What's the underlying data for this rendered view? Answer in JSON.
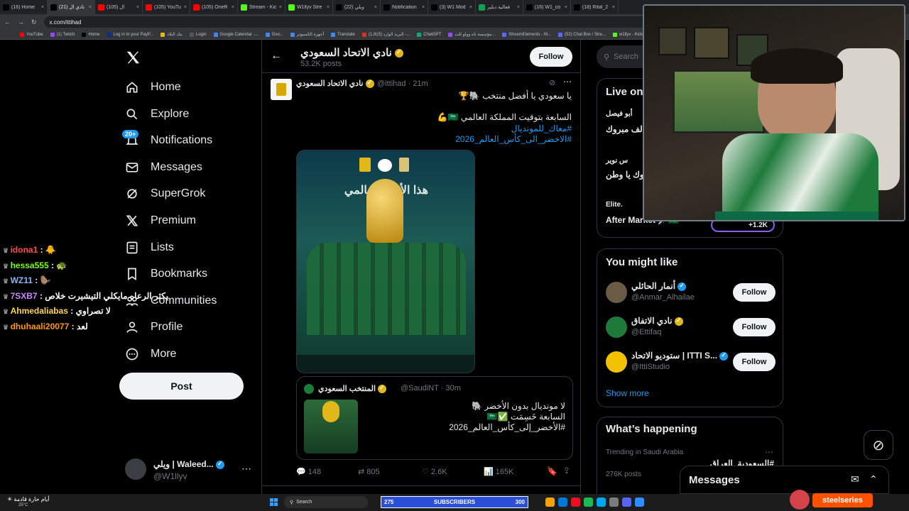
{
  "browser": {
    "tabs": [
      {
        "label": "(16) Home",
        "color": "#000000"
      },
      {
        "label": "(21) نادي ال",
        "color": "#000000",
        "active": true
      },
      {
        "label": "(105) ال",
        "color": "#ff0000"
      },
      {
        "label": "(105) YouTu",
        "color": "#ff0000"
      },
      {
        "label": "(105) OneR",
        "color": "#ff0000"
      },
      {
        "label": "Stream - Kic",
        "color": "#53fc18"
      },
      {
        "label": "W1llyv Stre",
        "color": "#53fc18"
      },
      {
        "label": "(22) ويلي",
        "color": "#000000"
      },
      {
        "label": "Notification",
        "color": "#000000"
      },
      {
        "label": "(3) W1 Mod",
        "color": "#000000"
      },
      {
        "label": "فعالية ديلير",
        "color": "#0f9d58"
      },
      {
        "label": "(16) W1_co",
        "color": "#000000"
      },
      {
        "label": "(18) Rital_2",
        "color": "#000000"
      }
    ],
    "url": "x.com/ittihad",
    "bookmarks": [
      "YouTube",
      "(1) Twitch",
      "Home",
      "Log in to your PayP...",
      "بنك البلاد",
      "Login",
      "Google Calendar -...",
      "Goo...",
      "أجهزة الكمبيوتر",
      "Translate",
      "البريد الوارد (1,815) -...",
      "ChatGPT",
      "مؤسسة ناه وولو للت...",
      "StreamElements - M...",
      "(52) Chat Box / Stre...",
      "w1llyv - Kick Bots"
    ]
  },
  "nav": {
    "items": [
      {
        "name": "nav-home",
        "icon": "home-icon",
        "label": "Home"
      },
      {
        "name": "nav-explore",
        "icon": "search-icon",
        "label": "Explore"
      },
      {
        "name": "nav-notifications",
        "icon": "bell-icon",
        "label": "Notifications"
      },
      {
        "name": "nav-messages",
        "icon": "mail-icon",
        "label": "Messages"
      },
      {
        "name": "nav-supergrok",
        "icon": "grok-icon",
        "label": "SuperGrok"
      },
      {
        "name": "nav-premium",
        "icon": "x-logo-icon",
        "label": "Premium"
      },
      {
        "name": "nav-lists",
        "icon": "list-icon",
        "label": "Lists"
      },
      {
        "name": "nav-bookmarks",
        "icon": "bookmark-icon",
        "label": "Bookmarks"
      },
      {
        "name": "nav-communities",
        "icon": "people-icon",
        "label": "Communities"
      },
      {
        "name": "nav-profile",
        "icon": "person-icon",
        "label": "Profile"
      },
      {
        "name": "nav-more",
        "icon": "more-circle-icon",
        "label": "More"
      }
    ],
    "notif_badge": "20+",
    "post_label": "Post",
    "account": {
      "name": "ويلي | Waleed...",
      "handle": "@W1llyv"
    }
  },
  "profile_header": {
    "title": "نادي الاتحاد السعودي",
    "posts": "53.2K posts",
    "follow": "Follow"
  },
  "tweet": {
    "name": "نادي الاتحاد السعودي",
    "handle": "@ittihad",
    "time": "· 21m",
    "lines": [
      "يا سعودي يا أفضل منتخب 🐘🏆",
      "السابعة بتوقيت المملكة العالمي 🇸🇦💪"
    ],
    "hashtags": [
      "#معاك_للمونديال",
      "#الاخضر_الى_كأس_العالم_2026"
    ],
    "image_text": "هذا الأخضر عالمي",
    "quote": {
      "name": "المنتخب السعودي",
      "handle": "@SaudiNT",
      "time": "· 30m",
      "lines": [
        "لا مونديال بدون الأخضر 🐘",
        "السابعة خَسِمَت ✅🇸🇦",
        "#الأخضر_إلى_كأس_العالم_2026"
      ]
    },
    "stats": {
      "replies": "148",
      "reposts": "805",
      "likes": "2.6K",
      "views": "165K"
    }
  },
  "right": {
    "search_placeholder": "Search",
    "live_title": "Live on",
    "live_items": [
      {
        "name": "أبو فيصل",
        "text": "الف مبروك"
      },
      {
        "name": "س نوير",
        "text": "مبروك يا وطن"
      },
      {
        "name": "Elite.",
        "text": "After Market 🗡️🇸🇦"
      }
    ],
    "live_count": "+1.2K",
    "might_like_title": "You might like",
    "suggestions": [
      {
        "name": "أنمار الحائلي",
        "handle": "@Anmar_Alhailae",
        "follow": "Follow",
        "avatar_color": "#6b5a44"
      },
      {
        "name": "نادي الاتفاق",
        "handle": "@Ettifaq",
        "follow": "Follow",
        "avatar_color": "#1e7a3b"
      },
      {
        "name": "ستوديو الاتحاد | ITTI S...",
        "handle": "@IttiStudio",
        "follow": "Follow",
        "avatar_color": "#f2c200"
      }
    ],
    "show_more": "Show more",
    "happening_title": "What’s happening",
    "trend_context": "Trending in Saudi Arabia",
    "trend_name": "#السعودية_العراق",
    "trend_posts": "276K posts",
    "messages_label": "Messages"
  },
  "chat": [
    {
      "user": "idona1",
      "color": "#ff4d4d",
      "msg": ": 🐥"
    },
    {
      "user": "hessa555",
      "color": "#7cfc00",
      "msg": ": 🐢"
    },
    {
      "user": "WZ11",
      "color": "#8ab4f8",
      "msg": ": 🦫"
    },
    {
      "user": "7SXB7",
      "color": "#c58af9",
      "msg": ": يكثر الرعاه مايكلي التيشيرت خلاص"
    },
    {
      "user": "Ahmedaliabas",
      "color": "#ffd54f",
      "msg": ": لا تصراوي"
    },
    {
      "user": "dhuhaali20077",
      "color": "#ff9800",
      "msg": ": لعد"
    }
  ],
  "overlay": {
    "subs_count": "275",
    "subs_label": "SUBSCRIBERS",
    "subs_goal": "300",
    "brand": "steelseries",
    "weather_text": "أيام حارة قادمة",
    "weather_temp": "25°C",
    "taskbar_search": "Search"
  }
}
